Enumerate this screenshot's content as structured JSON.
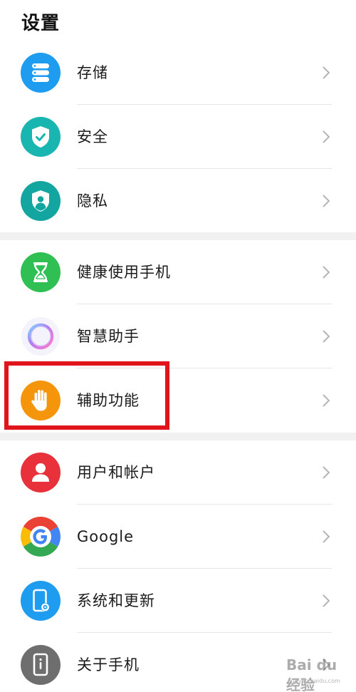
{
  "header": {
    "title": "设置"
  },
  "groups": [
    {
      "items": [
        {
          "label": "存储",
          "icon": "storage-icon",
          "color": "#1e9cf0"
        },
        {
          "label": "安全",
          "icon": "security-shield-icon",
          "color": "#19b6b1"
        },
        {
          "label": "隐私",
          "icon": "privacy-icon",
          "color": "#13a5a0"
        }
      ]
    },
    {
      "items": [
        {
          "label": "健康使用手机",
          "icon": "hourglass-icon",
          "color": "#2fbf53"
        },
        {
          "label": "智慧助手",
          "icon": "smart-assistant-icon",
          "color": "#b07cf0"
        },
        {
          "label": "辅助功能",
          "icon": "hand-icon",
          "color": "#f5950c"
        }
      ]
    },
    {
      "items": [
        {
          "label": "用户和帐户",
          "icon": "user-icon",
          "color": "#e8313a"
        },
        {
          "label": "Google",
          "icon": "google-icon",
          "color": "#4285f4"
        },
        {
          "label": "系统和更新",
          "icon": "system-update-icon",
          "color": "#1e9cf0"
        },
        {
          "label": "关于手机",
          "icon": "phone-info-icon",
          "color": "#6e6e6e"
        }
      ]
    }
  ],
  "watermark": {
    "text": "Bai du 经验",
    "sub": "jingyan.baidu.com"
  }
}
